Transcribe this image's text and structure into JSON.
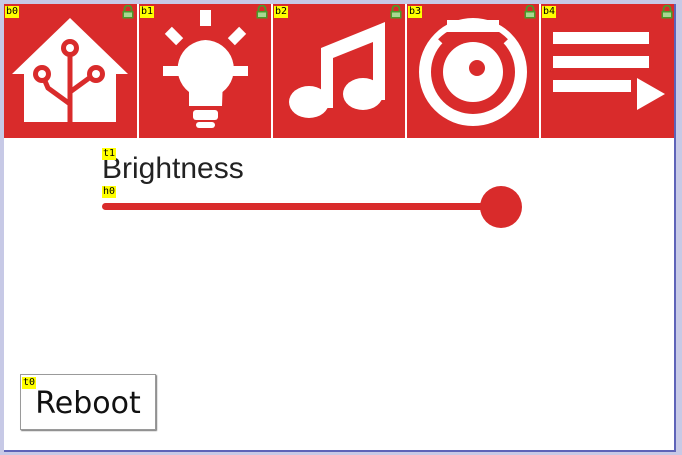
{
  "toolbar": {
    "tiles": [
      {
        "tag": "b0",
        "icon": "home-assistant-icon"
      },
      {
        "tag": "b1",
        "icon": "lightbulb-icon"
      },
      {
        "tag": "b2",
        "icon": "music-note-icon"
      },
      {
        "tag": "b3",
        "icon": "vacuum-icon"
      },
      {
        "tag": "b4",
        "icon": "playlist-play-icon"
      }
    ]
  },
  "brightness": {
    "tag": "t1",
    "label": "Brightness"
  },
  "slider": {
    "tag": "h0",
    "value_percent": 100
  },
  "reboot": {
    "tag": "t0",
    "label": "Reboot"
  },
  "colors": {
    "accent": "#d92b2b",
    "tag_bg": "#ffff00",
    "lock": "#4a9a2a",
    "frame_border": "#5e63b8"
  }
}
